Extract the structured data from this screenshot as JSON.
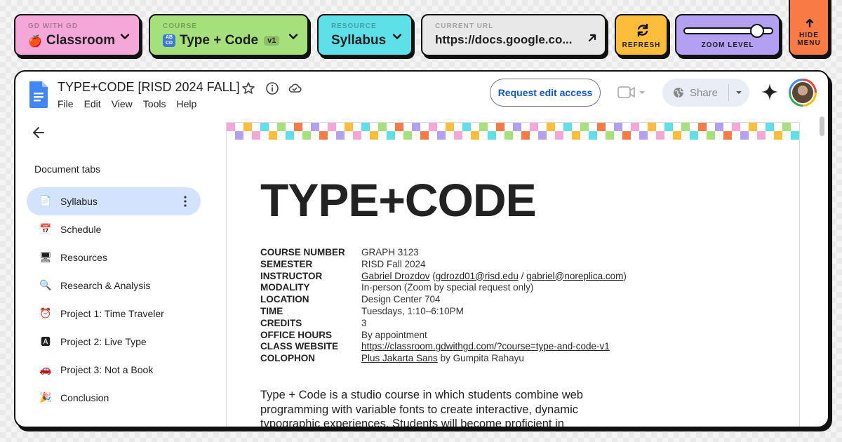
{
  "toolbar": {
    "classroom": {
      "small": "GD WITH GD",
      "emoji": "🍎",
      "label": "Classroom",
      "color": "#f4a7d8"
    },
    "course": {
      "small": "COURSE",
      "label": "Type + Code",
      "badge": "v1",
      "color": "#a6e07a"
    },
    "resource": {
      "small": "RESOURCE",
      "label": "Syllabus",
      "color": "#5ee0e8"
    },
    "url": {
      "small": "CURRENT URL",
      "value": "https://docs.google.co...",
      "color": "#e8e8e8"
    },
    "refresh": {
      "label": "REFRESH",
      "color": "#fcbd3a"
    },
    "zoom": {
      "label": "ZOOM LEVEL",
      "level": 0.88,
      "color": "#b3a0f2"
    },
    "hide_menu": {
      "line1": "HIDE",
      "line2": "MENU",
      "color": "#f97a45"
    }
  },
  "docs": {
    "title": "TYPE+CODE [RISD 2024 FALL]",
    "menu": [
      "File",
      "Edit",
      "View",
      "Tools",
      "Help"
    ],
    "request_access": "Request edit access",
    "share": "Share"
  },
  "sidebar": {
    "heading": "Document tabs",
    "tabs": [
      {
        "label": "Syllabus",
        "icon": "📄",
        "active": true
      },
      {
        "label": "Schedule",
        "icon": "📅"
      },
      {
        "label": "Resources",
        "icon": "🖥"
      },
      {
        "label": "Research & Analysis",
        "icon": "🔍"
      },
      {
        "label": "Project 1: Time Traveler",
        "icon": "⏰"
      },
      {
        "label": "Project 2: Live Type",
        "icon": "🅰"
      },
      {
        "label": "Project 3: Not a Book",
        "icon": "🚗"
      },
      {
        "label": "Conclusion",
        "icon": "🎉"
      }
    ]
  },
  "doc": {
    "heading": "TYPE+CODE",
    "info": {
      "course_number": {
        "label": "COURSE NUMBER",
        "value": "GRAPH 3123"
      },
      "semester": {
        "label": "SEMESTER",
        "value": "RISD Fall 2024"
      },
      "instructor": {
        "label": "INSTRUCTOR",
        "name": "Gabriel Drozdov",
        "email1": "gdrozd01@risd.edu",
        "email2": "gabriel@noreplica.com"
      },
      "modality": {
        "label": "MODALITY",
        "value": "In-person (Zoom by special request only)"
      },
      "location": {
        "label": "LOCATION",
        "value": "Design Center 704"
      },
      "time": {
        "label": "TIME",
        "value": "Tuesdays, 1:10–6:10PM"
      },
      "credits": {
        "label": "CREDITS",
        "value": "3"
      },
      "office_hours": {
        "label": "OFFICE HOURS",
        "value": "By appointment"
      },
      "class_website": {
        "label": "CLASS WEBSITE",
        "value": "https://classroom.gdwithgd.com/?course=type-and-code-v1"
      },
      "colophon": {
        "label": "COLOPHON",
        "font": "Plus Jakarta Sans",
        "by": "by Gumpita Rahayu"
      }
    },
    "paragraph": "Type + Code is a studio course in which students combine web programming with variable fonts to create interactive, dynamic typographic experiences. Students will become proficient in"
  }
}
